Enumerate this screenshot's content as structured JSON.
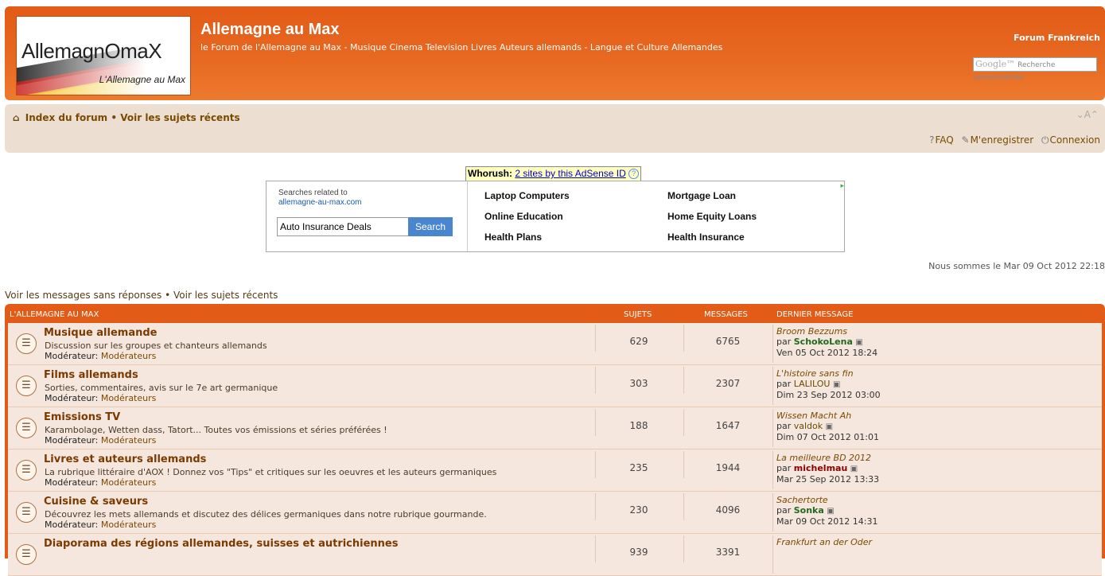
{
  "header": {
    "logo_name": "AllemagnOmaX",
    "logo_tagline": "L'Allemagne au Max",
    "site_title": "Allemagne au Max",
    "site_description": "le Forum de l'Allemagne au Max - Musique Cinema Television Livres Auteurs allemands - Langue et Culture Allemandes",
    "forum_link": "Forum Frankreich",
    "search_placeholder": "Recherche personnalisée",
    "search_brand": "Google™"
  },
  "navbar": {
    "breadcrumb_home": "Index du forum",
    "breadcrumb_sep": "•",
    "breadcrumb_recent": "Voir les sujets récents",
    "font_size": "⌄A⌃",
    "faq": "FAQ",
    "register": "M'enregistrer",
    "login": "Connexion"
  },
  "whorush": {
    "label": "Whorush:",
    "link": "2 sites by this AdSense ID",
    "help": "?"
  },
  "ad": {
    "related_label": "Searches related to",
    "related_domain": "allemagne-au-max.com",
    "input_value": "Auto Insurance Deals",
    "button": "Search",
    "links": [
      "Laptop Computers",
      "Mortgage Loan",
      "Online Education",
      "Home Equity Loans",
      "Health Plans",
      "Health Insurance"
    ]
  },
  "datetime": "Nous sommes le Mar 09 Oct 2012 22:18",
  "quicklinks": {
    "unanswered": "Voir les messages sans réponses",
    "sep": "•",
    "recent": "Voir les sujets récents"
  },
  "table": {
    "category": "L'ALLEMAGNE AU MAX",
    "col_topics": "SUJETS",
    "col_posts": "MESSAGES",
    "col_last": "DERNIER MESSAGE",
    "mod_label": "Modérateur:",
    "mod_link": "Modérateurs",
    "by": "par",
    "rows": [
      {
        "title": "Musique allemande",
        "desc": "Discussion sur les groupes et chanteurs allemands",
        "topics": "629",
        "posts": "6765",
        "last_title": "Broom Bezzums",
        "last_user": "SchokoLena",
        "last_date": "Ven 05 Oct 2012 18:24"
      },
      {
        "title": "Films allemands",
        "desc": "Sorties, commentaires, avis sur le 7e art germanique",
        "topics": "303",
        "posts": "2307",
        "last_title": "L'histoire sans fin",
        "last_user": "LALILOU",
        "last_date": "Dim 23 Sep 2012 03:00"
      },
      {
        "title": "Emissions TV",
        "desc": "Karambolage, Wetten dass, Tatort... Toutes vos émissions et séries préférées !",
        "topics": "188",
        "posts": "1647",
        "last_title": "Wissen Macht Ah",
        "last_user": "valdok",
        "last_date": "Dim 07 Oct 2012 01:01"
      },
      {
        "title": "Livres et auteurs allemands",
        "desc": "La rubrique littéraire d'AOX ! Donnez vos \"Tips\" et critiques sur les oeuvres et les auteurs germaniques",
        "topics": "235",
        "posts": "1944",
        "last_title": "La meilleure BD 2012",
        "last_user": "michelmau",
        "last_date": "Mar 25 Sep 2012 13:33"
      },
      {
        "title": "Cuisine & saveurs",
        "desc": "Découvrez les mets allemands et discutez des délices germaniques dans notre rubrique gourmande.",
        "topics": "230",
        "posts": "4096",
        "last_title": "Sachertorte",
        "last_user": "Sonka",
        "last_date": "Mar 09 Oct 2012 14:31"
      },
      {
        "title": "Diaporama des régions allemandes, suisses et autrichiennes",
        "desc": "",
        "topics": "939",
        "posts": "3391",
        "last_title": "Frankfurt an der Oder",
        "last_user": "",
        "last_date": ""
      }
    ]
  }
}
